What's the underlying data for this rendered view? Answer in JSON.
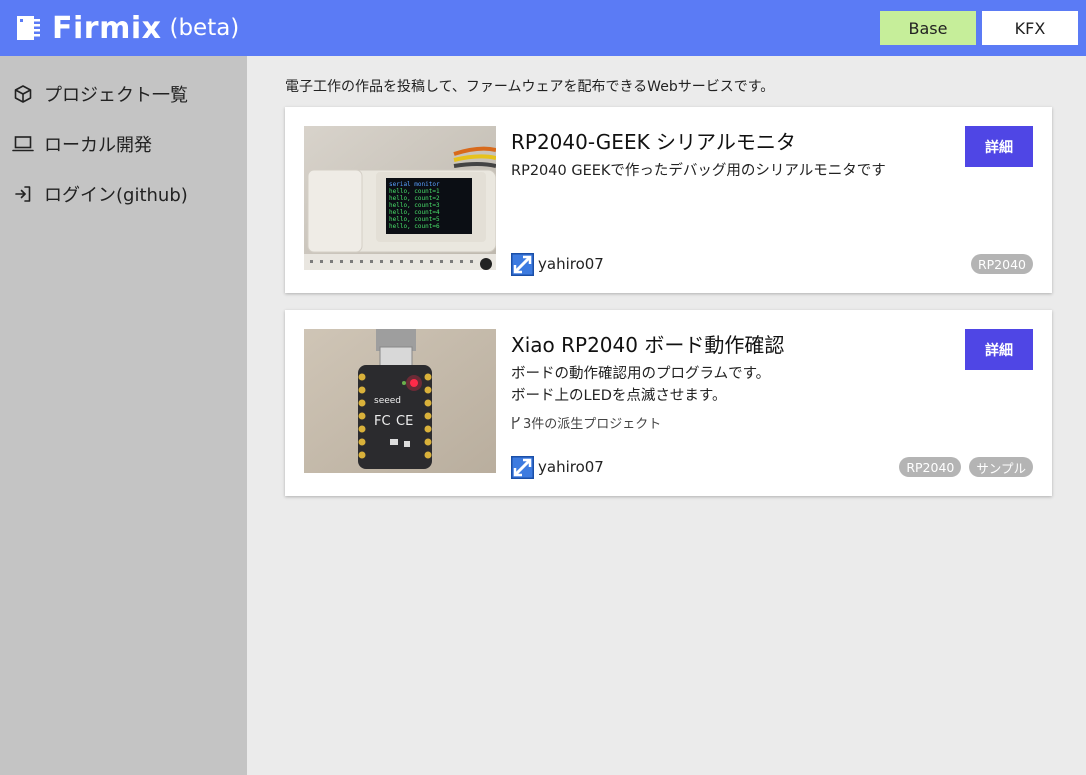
{
  "header": {
    "app_name": "Firmix",
    "app_suffix": "(beta)",
    "mode_base": "Base",
    "mode_kfx": "KFX",
    "bar_color": "#5b7bf5"
  },
  "sidebar": {
    "items": [
      {
        "label": "プロジェクト一覧",
        "icon": "cube-icon"
      },
      {
        "label": "ローカル開発",
        "icon": "laptop-icon"
      },
      {
        "label": "ログイン(github)",
        "icon": "login-icon"
      }
    ]
  },
  "main": {
    "intro": "電子工作の作品を投稿して、ファームウェアを配布できるWebサービスです。",
    "projects": [
      {
        "title": "RP2040-GEEK シリアルモニタ",
        "description": [
          "RP2040 GEEKで作ったデバッグ用のシリアルモニタです"
        ],
        "author": "yahiro07",
        "detail_label": "詳細",
        "tags": [
          "RP2040"
        ],
        "screen_lines": [
          "serial monitor",
          "hello, count=1",
          "hello, count=2",
          "hello, count=3",
          "hello, count=4",
          "hello, count=5",
          "hello, count=6"
        ]
      },
      {
        "title": "Xiao RP2040 ボード動作確認",
        "description": [
          "ボードの動作確認用のプログラムです。",
          "ボード上のLEDを点滅させます。"
        ],
        "derived": "3件の派生プロジェクト",
        "author": "yahiro07",
        "detail_label": "詳細",
        "tags": [
          "RP2040",
          "サンプル"
        ],
        "board_brand": "seeed"
      }
    ]
  }
}
